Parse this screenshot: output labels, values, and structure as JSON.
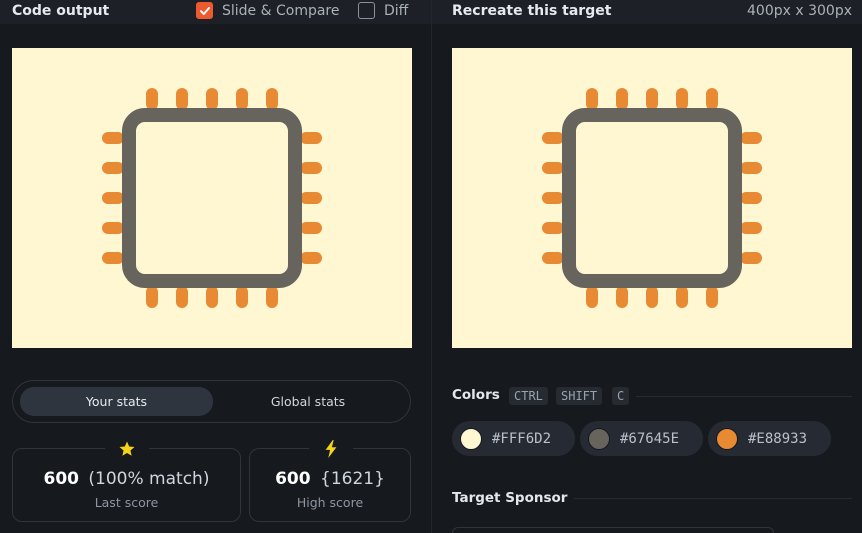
{
  "left_panel": {
    "title": "Code output",
    "slide_compare": {
      "label": "Slide & Compare",
      "checked": true
    },
    "diff": {
      "label": "Diff",
      "checked": false
    }
  },
  "right_panel": {
    "title": "Recreate this target",
    "dimensions": "400px x 300px"
  },
  "canvas": {
    "background": "#FFF6D2",
    "chip_body": "#67645E",
    "pins": "#E88933",
    "icon": "cpu-chip-icon"
  },
  "stats": {
    "tabs": {
      "active": "Your stats",
      "inactive": "Global stats"
    },
    "last": {
      "icon": "star-icon",
      "score": "600",
      "extra": "(100% match)",
      "label": "Last score",
      "icon_color": "#f7d21a"
    },
    "high": {
      "icon": "bolt-icon",
      "score": "600",
      "extra": "{1621}",
      "label": "High score",
      "icon_color": "#f7d21a"
    }
  },
  "colors_section": {
    "label": "Colors",
    "shortcut": [
      "CTRL",
      "SHIFT",
      "C"
    ],
    "swatches": [
      {
        "hex": "#FFF6D2"
      },
      {
        "hex": "#67645E"
      },
      {
        "hex": "#E88933"
      }
    ]
  },
  "sponsor_section": {
    "label": "Target Sponsor"
  }
}
